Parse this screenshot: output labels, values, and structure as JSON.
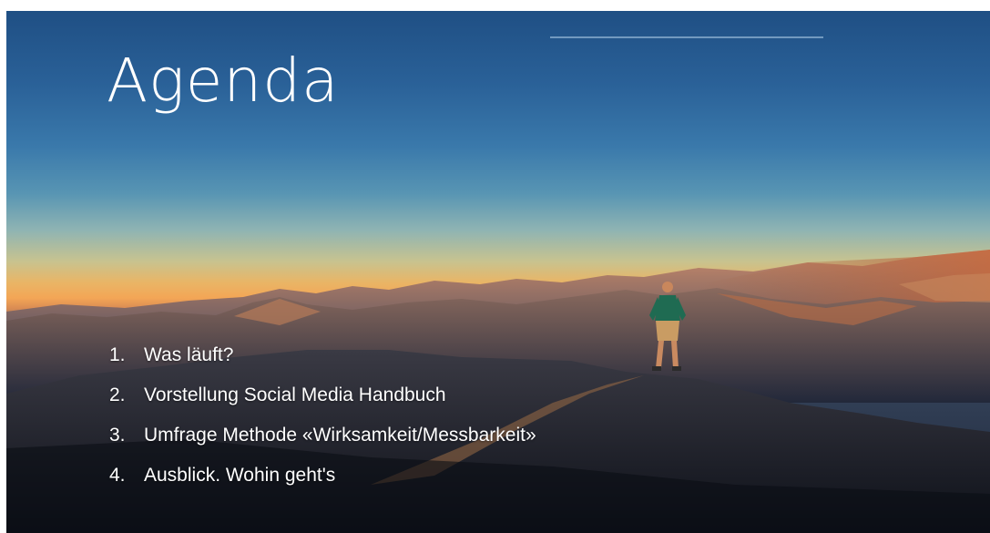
{
  "slide": {
    "title": "Agenda",
    "items": [
      {
        "number": "1.",
        "text": "Was läuft?"
      },
      {
        "number": "2.",
        "text": "Vorstellung Social Media Handbuch"
      },
      {
        "number": "3.",
        "text": "Umfrage Methode «Wirksamkeit/Messbarkeit»"
      },
      {
        "number": "4.",
        "text": "Ausblick. Wohin geht's"
      }
    ]
  }
}
